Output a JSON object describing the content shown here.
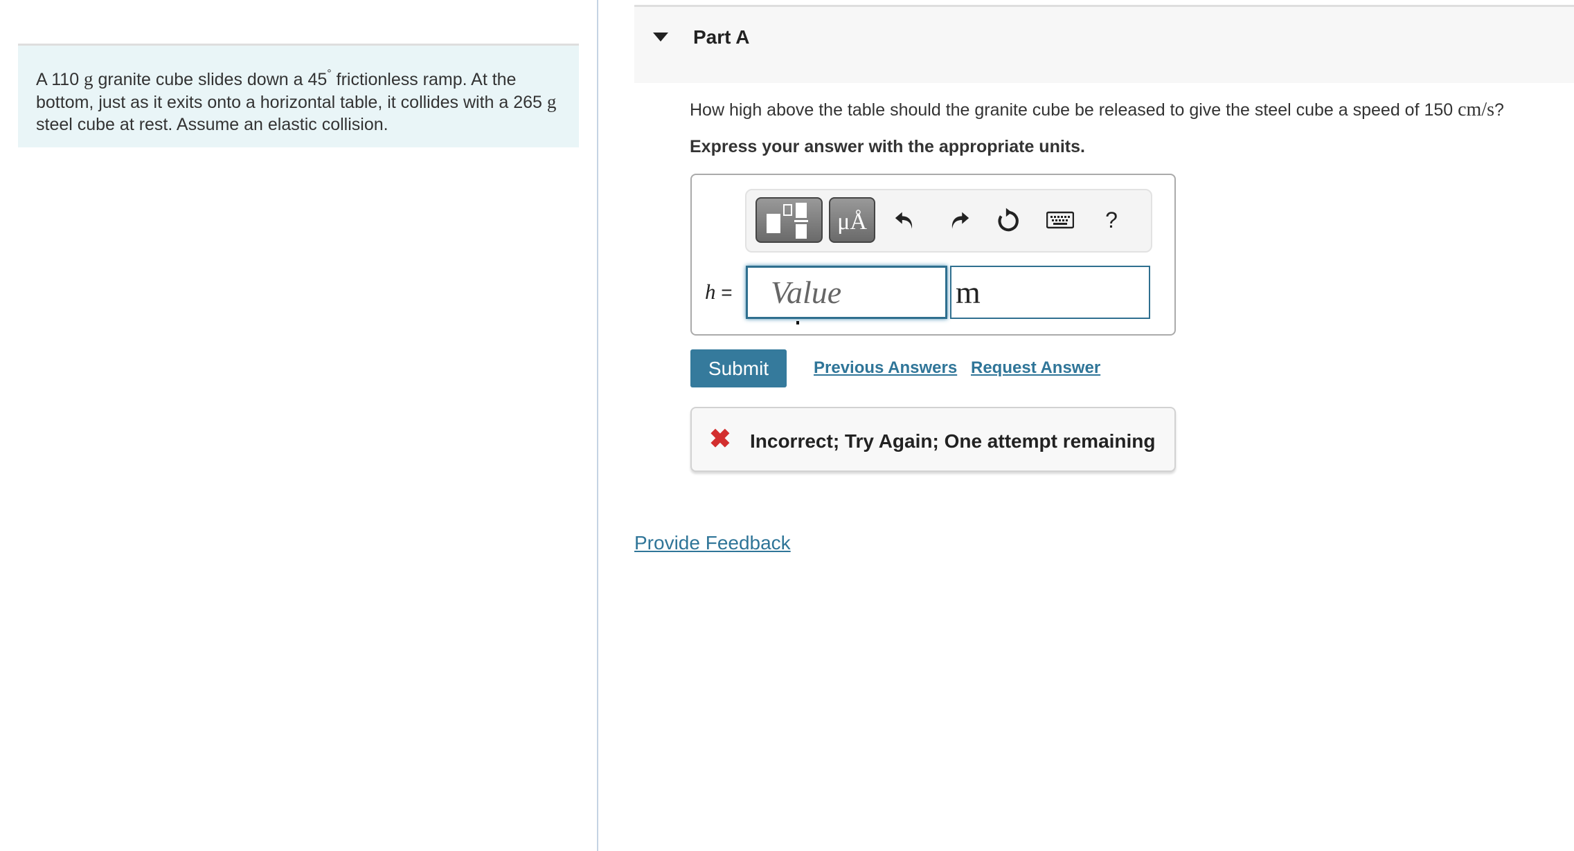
{
  "problem": {
    "intro_pre1": "A 110 ",
    "unit_g1": "g",
    "intro_mid1": " granite cube slides down a 45",
    "degree": "°",
    "intro_mid2": " frictionless ramp. At the bottom, just as it exits onto a horizontal table, it collides with a 265 ",
    "unit_g2": "g",
    "intro_post": " steel cube at rest. Assume an elastic collision."
  },
  "part": {
    "title": "Part A",
    "expanded": true,
    "question_pre": "How high above the table should the granite cube be released to give the steel cube a speed of 150 ",
    "question_unit": "cm/s",
    "question_post": "?",
    "instruction": "Express your answer with the appropriate units."
  },
  "toolbar": {
    "buttons": [
      {
        "name": "templates",
        "icon": "fraction-template-icon"
      },
      {
        "name": "units",
        "label": "μÅ",
        "icon": "units-icon"
      },
      {
        "name": "undo",
        "icon": "undo-icon"
      },
      {
        "name": "redo",
        "icon": "redo-icon"
      },
      {
        "name": "reset",
        "icon": "reset-icon"
      },
      {
        "name": "keyboard",
        "icon": "keyboard-icon"
      },
      {
        "name": "help",
        "label": "?",
        "icon": "help-icon"
      }
    ]
  },
  "answer": {
    "variable": "h",
    "equals": "=",
    "value": "",
    "value_placeholder": "Value",
    "unit": "m"
  },
  "actions": {
    "submit": "Submit",
    "previous_answers": "Previous Answers",
    "request_answer": "Request Answer"
  },
  "feedback": {
    "status": "incorrect",
    "message": "Incorrect; Try Again; One attempt remaining"
  },
  "footer": {
    "provide_feedback": "Provide Feedback"
  },
  "colors": {
    "accent": "#357a9c",
    "link": "#2f7598",
    "error": "#d32f2f",
    "intro_bg": "#e9f5f7"
  }
}
